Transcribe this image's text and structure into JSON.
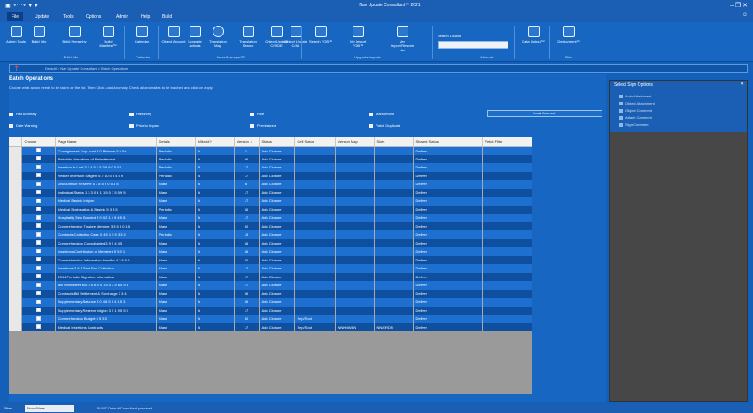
{
  "titlebar": {
    "title": "Nav Update Consultant™ 2021",
    "quick_access": "▣ ↶ ↷ ▾ ▾",
    "window_controls": "–  ❐  ✕"
  },
  "tabs": [
    "File",
    "Update",
    "Tools",
    "Options",
    "Admin",
    "Help",
    "Build"
  ],
  "user_chip": "☺",
  "ribbon": {
    "buttons": [
      {
        "label": "Admin Tools",
        "icon": "house-icon"
      },
      {
        "label": "Build Info",
        "icon": "house-icon"
      },
      {
        "label": "Build Hierarchy",
        "icon": "fork-icon"
      },
      {
        "label": "Build Manifest™",
        "icon": "document-icon"
      },
      {
        "label": "Calendar",
        "icon": "calendar-icon"
      },
      {
        "label": "Object Account",
        "icon": "grid-icon"
      },
      {
        "label": "Upgrade Actions",
        "icon": "grid-icon"
      },
      {
        "label": "Translation Map",
        "icon": "globe-icon"
      },
      {
        "label": "Translation Search",
        "icon": "table-icon"
      },
      {
        "label": "Object Update C/SIDE",
        "icon": "table-icon"
      },
      {
        "label": "Object Update C/AL",
        "icon": "table-icon"
      },
      {
        "label": "Search FOB™",
        "icon": "database-icon"
      },
      {
        "label": "Ver Import FOB™",
        "icon": "document-icon"
      },
      {
        "label": "Ver Import/Restore Ver",
        "icon": "document-icon"
      },
      {
        "label": "Data Output™",
        "icon": "monitor-icon"
      },
      {
        "label": "Deployment™",
        "icon": "box-icon"
      }
    ],
    "groups": [
      "Build Info",
      "Calendar",
      "Areas/Manager™",
      "Upgrade/Imports",
      "Manuals",
      "Plan"
    ],
    "search_label": "Search L/Build",
    "search_value": ""
  },
  "locbar": {
    "pin": "📍",
    "path": "Default > Nav Update Consultant > Batch Operations"
  },
  "panel": {
    "title": "Batch Operations",
    "description": "Choose what action needs to be taken on the list. Then Click Load Anomaly. Check all anomalies to be batched and click on apply.",
    "options_row1": [
      "Hist Anomaly",
      "Hierarchy",
      "Rule",
      "Marshmonit"
    ],
    "options_row2": [
      "Date Warning",
      "Prior to Impact",
      "Permissions",
      "Patch Duplicate"
    ],
    "load_button": "Load Anomaly"
  },
  "grid": {
    "columns": [
      "Choose",
      "Page Name",
      "Details",
      "Mikroid?",
      "Version ↓",
      "Status",
      "Cell Status",
      "Version Map",
      "Slots",
      "Shared Status",
      "Fetch Filter"
    ],
    "rows": [
      [
        "",
        "Consignment: Sup. cust 3.0 Balance 5 5 5+",
        "Periodic",
        "A",
        "1",
        "Add Closure",
        "",
        "",
        "",
        "Deliver",
        ""
      ],
      [
        "",
        "Rebuilds alienations of Reinstalment",
        "Periodic",
        "A",
        "96",
        "Add Closure",
        "",
        "",
        "",
        "Deliver",
        ""
      ],
      [
        "",
        "Insertion to Lord 3 1 4 5 1 5 3 8 9 0 5 5 1",
        "Periodic",
        "B",
        "17",
        "Add Closure",
        "",
        "",
        "",
        "Deliver",
        ""
      ],
      [
        "",
        "Helicer Insersion Stagent 6 7 10 5 3 4 5 9",
        "Periodic",
        "A",
        "17",
        "Add Closure",
        "",
        "",
        "",
        "Deliver",
        ""
      ],
      [
        "",
        "Discounts of Reserve 5 3 8 5 9 0 5 1 6",
        "Mass",
        "A",
        "6",
        "Add Closure",
        "",
        "",
        "",
        "Deliver",
        ""
      ],
      [
        "",
        "Individual Status 1 3 3 0 4 1 1 5 0 1 5 5 9 5",
        "Mass",
        "A",
        "17",
        "Add Closure",
        "",
        "",
        "",
        "Deliver",
        ""
      ],
      [
        "",
        "Medical Basinic Intgion",
        "Mass",
        "A",
        "17",
        "Add Closure",
        "",
        "",
        "",
        "Deliver",
        ""
      ],
      [
        "",
        "Medical Brainstation & Basinic 5 3 3 5",
        "Periodic",
        "A",
        "66",
        "Add Closure",
        "",
        "",
        "",
        "Deliver",
        ""
      ],
      [
        "",
        "Hospitality Sect Bonded 3 9 0 2 1 4 9 4 5 5",
        "Mass",
        "A",
        "17",
        "Add Closure",
        "",
        "",
        "",
        "Deliver",
        ""
      ],
      [
        "",
        "Comprehensive Trustee Member 3 3 5 9 0 1 5",
        "Mass",
        "A",
        "80",
        "Add Closure",
        "",
        "",
        "",
        "Deliver",
        ""
      ],
      [
        "",
        "Contracts Collection Case 0 4 5 1 5 9 3 3 2",
        "Periodic",
        "A",
        "15",
        "Add Closure",
        "",
        "",
        "",
        "Deliver",
        ""
      ],
      [
        "",
        "Comprehension Consolidated 3 9 5 4 4 5",
        "Mass",
        "A",
        "66",
        "Add Closure",
        "",
        "",
        "",
        "Deliver",
        ""
      ],
      [
        "",
        "Insertions Contribution of Members 5 5 9 1",
        "Mass",
        "A",
        "66",
        "Add Closure",
        "",
        "",
        "",
        "Deliver",
        ""
      ],
      [
        "",
        "Comprehensive Information Handler 4 3 5 6 5",
        "Mass",
        "A",
        "80",
        "Add Closure",
        "",
        "",
        "",
        "Deliver",
        ""
      ],
      [
        "",
        "Insertions 3 9 1 Sect Bnd Collection",
        "Mass",
        "A",
        "17",
        "Add Closure",
        "",
        "",
        "",
        "Deliver",
        ""
      ],
      [
        "",
        "2014 Periodic Migration Information",
        "Mass",
        "A",
        "17",
        "Add Closure",
        "",
        "",
        "",
        "Deliver",
        ""
      ],
      [
        "",
        "Bill Worksheet acc 3 5 8 9 4 1 5 4 2 5 6 5 5 8",
        "Mass",
        "A",
        "17",
        "Add Closure",
        "",
        "",
        "",
        "Deliver",
        ""
      ],
      [
        "",
        "Contracts Bill Settlement & Surcharge 3 3 4",
        "Mass",
        "A",
        "66",
        "Add Closure",
        "",
        "",
        "",
        "Deliver",
        ""
      ],
      [
        "",
        "Supplementary Balance 3 0 4 8 5 9 4 1 5 3",
        "Mass",
        "A",
        "66",
        "Add Closure",
        "",
        "",
        "",
        "Deliver",
        ""
      ],
      [
        "",
        "Supplementary Reserve Intgion 3 5 1 9 5 5 0",
        "Mass",
        "A",
        "17",
        "Add Closure",
        "",
        "",
        "",
        "Deliver",
        ""
      ],
      [
        "",
        "Comprehension Budget 6 5 5 3",
        "Mass",
        "A",
        "80",
        "Add Closure",
        "Sep/Spot",
        "",
        "",
        "Deliver",
        ""
      ],
      [
        "",
        "Medical Insertions Contracts",
        "Mass",
        "A",
        "17",
        "Add Closure",
        "Sep/Spot",
        "NNKNW&N",
        "NN/ERDN",
        "Deliver",
        ""
      ]
    ]
  },
  "right_panel": {
    "title": "Select Sign Options",
    "items": [
      "Auto Attachment",
      "Object Attachment",
      "Object Comment",
      "Attach Comment",
      "Sign Comment"
    ]
  },
  "statusbar": {
    "label": "Filter:",
    "box_value": "Blood/Mass",
    "text": "BUILT Default Consultant prepared"
  }
}
